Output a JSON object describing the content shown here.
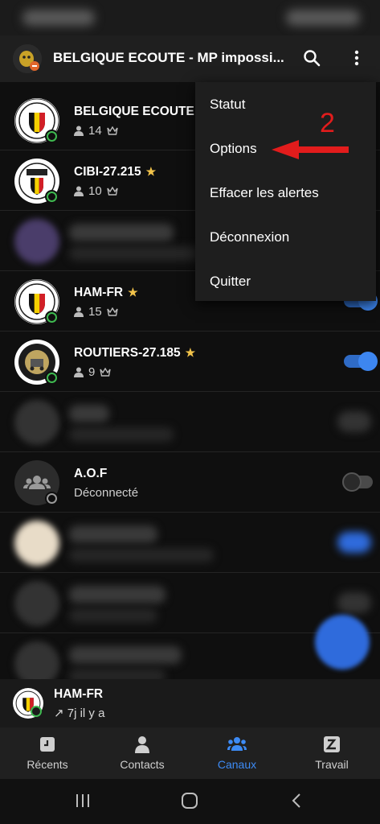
{
  "app_bar": {
    "title": "BELGIQUE ECOUTE - MP impossi..."
  },
  "channels": [
    {
      "name": "BELGIQUE ECOUTE",
      "starred": true,
      "members": "14",
      "toggle": "on"
    },
    {
      "name": "CIBI-27.215",
      "starred": true,
      "members": "10",
      "toggle": "on"
    },
    {
      "name": "HAM-FR",
      "starred": true,
      "members": "15",
      "toggle": "on"
    },
    {
      "name": "ROUTIERS-27.185",
      "starred": true,
      "members": "9",
      "toggle": "on"
    },
    {
      "name": "A.O.F",
      "status": "Déconnecté",
      "toggle": "off"
    }
  ],
  "star_glyph": "★",
  "menu": {
    "items": [
      "Statut",
      "Options",
      "Effacer les alertes",
      "Déconnexion",
      "Quitter"
    ]
  },
  "annotation": {
    "number": "2",
    "color": "#e21c1c"
  },
  "now_playing": {
    "name": "HAM-FR",
    "time": "↗ 7j il y a"
  },
  "tabs": [
    {
      "label": "Récents",
      "icon": "recent-icon"
    },
    {
      "label": "Contacts",
      "icon": "person-icon"
    },
    {
      "label": "Canaux",
      "icon": "group-icon",
      "active": true
    },
    {
      "label": "Travail",
      "icon": "work-icon"
    }
  ],
  "colors": {
    "accent": "#3d8bf5",
    "online": "#3fb950",
    "star": "#f2c34a"
  }
}
